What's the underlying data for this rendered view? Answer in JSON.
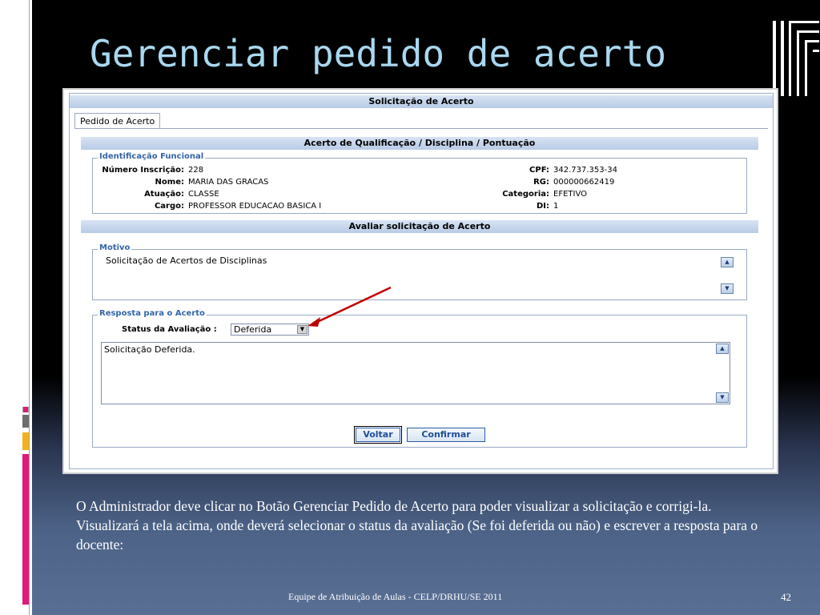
{
  "slide": {
    "title": "Gerenciar pedido de acerto",
    "description": "O Administrador deve clicar no Botão Gerenciar Pedido de Acerto para poder visualizar a solicitação e corrigi-la. Visualizará a tela acima, onde deverá selecionar o status da avaliação (Se foi deferida ou não) e escrever a resposta para o docente:",
    "footer": "Equipe de Atribuição de Aulas - CELP/DRHU/SE  2011",
    "page_number": "42"
  },
  "screen": {
    "window_title": "Solicitação de Acerto",
    "tab_label": "Pedido de Acerto",
    "section_1_title": "Acerto de Qualificação / Disciplina / Pontuação",
    "identificacao": {
      "legend": "Identificação Funcional",
      "left": [
        {
          "label": "Número Inscrição:",
          "value": "228"
        },
        {
          "label": "Nome:",
          "value": "MARIA DAS GRACAS"
        },
        {
          "label": "Atuação:",
          "value": "CLASSE"
        },
        {
          "label": "Cargo:",
          "value": "PROFESSOR EDUCACAO BASICA I"
        }
      ],
      "right": [
        {
          "label": "CPF:",
          "value": "342.737.353-34"
        },
        {
          "label": "RG:",
          "value": "000000662419"
        },
        {
          "label": "Categoria:",
          "value": "EFETIVO"
        },
        {
          "label": "DI:",
          "value": "1"
        }
      ]
    },
    "section_2_title": "Avaliar solicitação de Acerto",
    "motivo": {
      "legend": "Motivo",
      "text": "Solicitação de Acertos de Disciplinas"
    },
    "resposta": {
      "legend": "Resposta para o Acerto",
      "status_label": "Status da Avaliação :",
      "status_value": "Deferida",
      "response_text": "Solicitação Deferida."
    },
    "buttons": {
      "voltar": "Voltar",
      "confirmar": "Confirmar"
    }
  },
  "colors": {
    "title": "#a9d8f0",
    "header_bar": "#c6d6ee",
    "legend": "#3366aa",
    "button_text": "#1d4f99",
    "arrow": "#c00000",
    "accent_magenta": "#e0197a",
    "accent_yellow": "#f2b21c"
  }
}
